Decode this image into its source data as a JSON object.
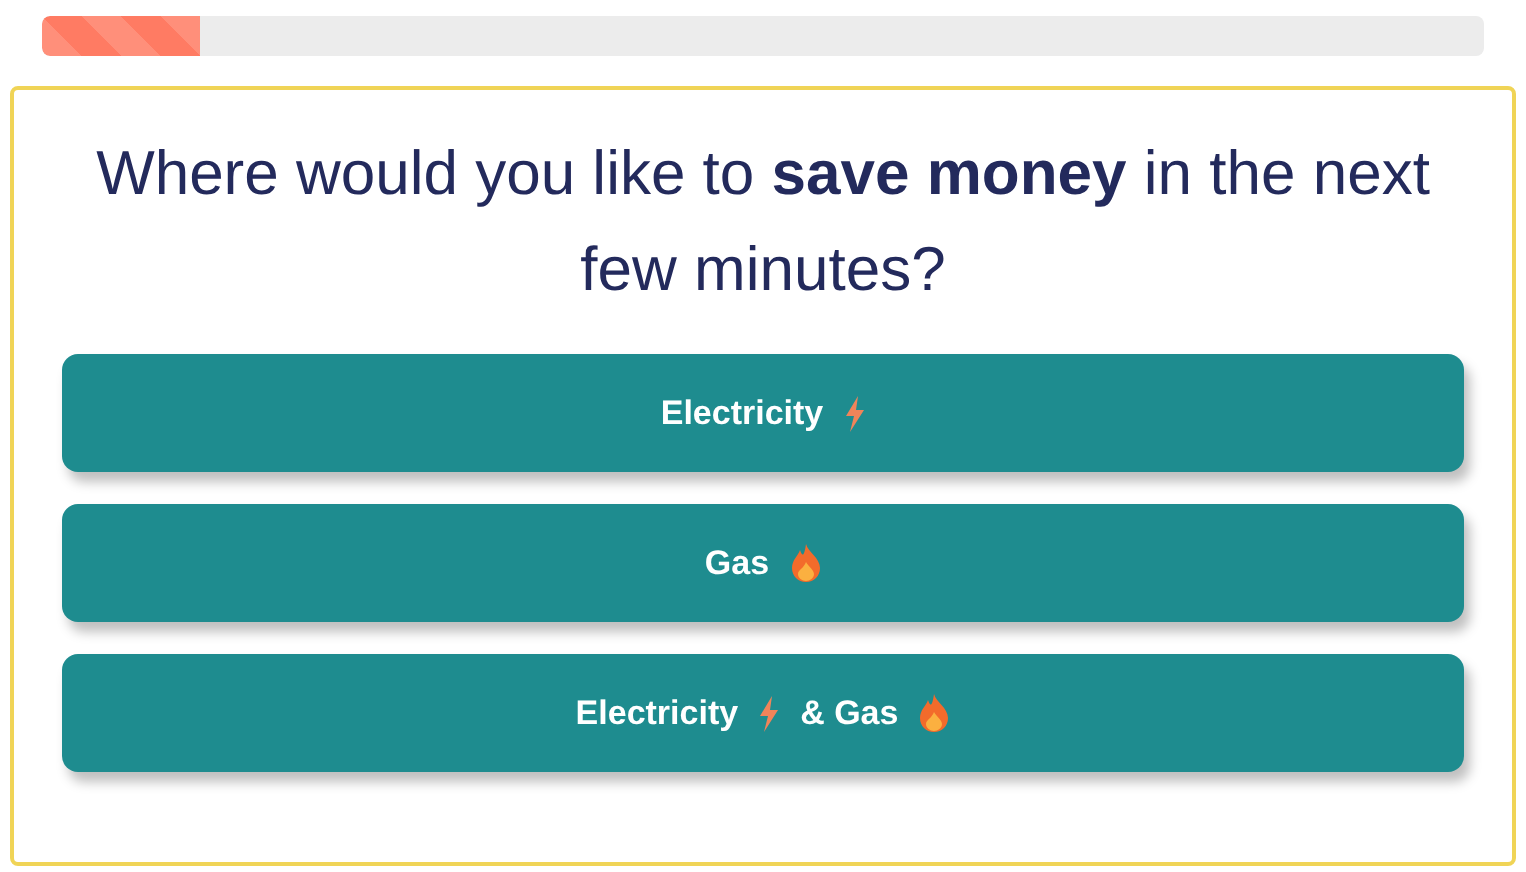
{
  "progress": {
    "level": 0.11
  },
  "question": "Where would you like to **save money** in the next few minutes?",
  "options": [
    {
      "parts": [
        {
          "kind": "text",
          "text": "Electricity"
        },
        {
          "kind": "bolt"
        }
      ]
    },
    {
      "parts": [
        {
          "kind": "text",
          "text": "Gas"
        },
        {
          "kind": "flame"
        }
      ]
    },
    {
      "parts": [
        {
          "kind": "text",
          "text": "Electricity"
        },
        {
          "kind": "bolt"
        },
        {
          "kind": "text",
          "text": "& Gas"
        },
        {
          "kind": "flame"
        }
      ]
    }
  ]
}
